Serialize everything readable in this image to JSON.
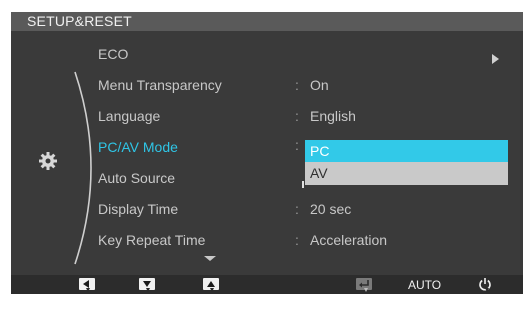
{
  "title": "SETUP&RESET",
  "menu": {
    "items": [
      {
        "label": "ECO",
        "value": ""
      },
      {
        "label": "Menu Transparency",
        "value": "On"
      },
      {
        "label": "Language",
        "value": "English"
      },
      {
        "label": "PC/AV Mode",
        "value": ""
      },
      {
        "label": "Auto Source",
        "value": ""
      },
      {
        "label": "Display Time",
        "value": "20 sec"
      },
      {
        "label": "Key Repeat Time",
        "value": "Acceleration"
      }
    ],
    "colon": ":"
  },
  "dropdown": {
    "options": [
      "PC",
      "AV"
    ],
    "selected": "PC"
  },
  "footer": {
    "auto_label": "AUTO"
  },
  "colors": {
    "accent": "#32c9e8",
    "active_text": "#2fc5e6",
    "background": "#3a3a3a"
  },
  "icons": {
    "section": "gear-icon",
    "submenu": "arrow-right-icon",
    "more": "chevron-down-icon",
    "buttons": [
      "left-arrow-icon",
      "down-arrow-icon",
      "up-arrow-icon",
      "enter-icon",
      "power-icon"
    ]
  }
}
